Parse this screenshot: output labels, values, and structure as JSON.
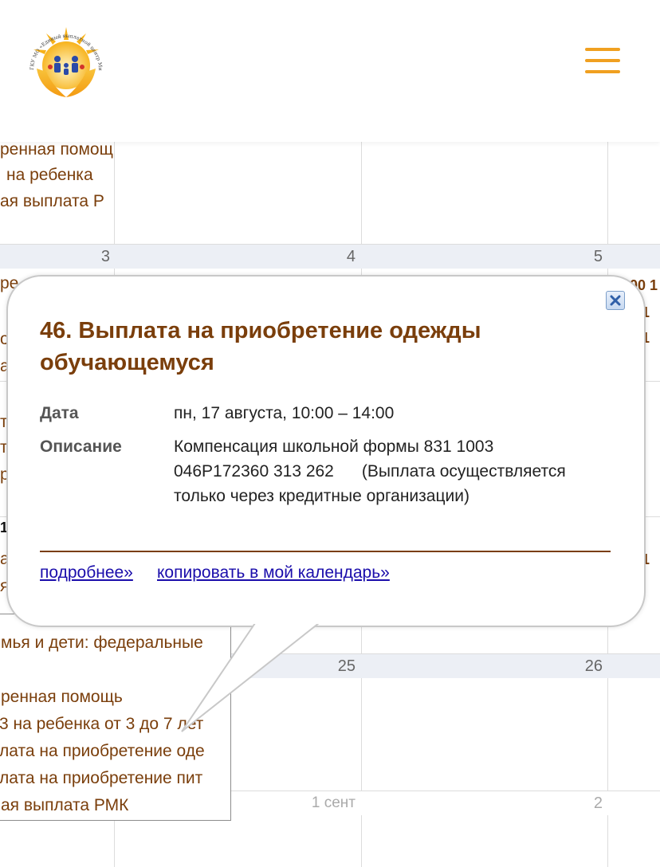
{
  "header": {
    "logo_text": "ГКУ МО «Единый выплатной центр Минсоцразвития»",
    "accent": "#f0a020"
  },
  "calendar": {
    "day_numbers": [
      "3",
      "4",
      "5",
      "25",
      "26",
      "1 сент",
      "2"
    ],
    "events_top": [
      "ренная помощ",
      "на ребенка",
      "ая выплата Р"
    ],
    "events_bottom": [
      "мья и дети: федеральные",
      "ренная помощь",
      "3 на ребенка от 3 до 7 лет",
      "лата на приобретение оде",
      "лата на приобретение пит",
      "ая выплата РМК"
    ],
    "partial_right": [
      "00 1",
      "0 1",
      "0 1",
      "0 1"
    ],
    "partial_left": [
      "ре",
      "р",
      "од",
      "ая",
      "т",
      "т",
      "ре",
      "е",
      "1",
      "ая",
      "я",
      "ая и"
    ]
  },
  "popup": {
    "title": "46. Выплата на приобретение одежды обучающемуся",
    "date_label": "Дата",
    "date_value": "пн, 17 августа, 10:00 – 14:00",
    "description_label": "Описание",
    "description_value": "Компенсация школьной формы 831 1003 046Р172360 313 262      (Выплата осуществляется только через кредитные организации)",
    "more_link": "подробнее»",
    "copy_link": "копировать в мой календарь»",
    "close_icon": "close-icon",
    "title_color": "#7a3e0b",
    "link_color": "#1a0dab"
  }
}
